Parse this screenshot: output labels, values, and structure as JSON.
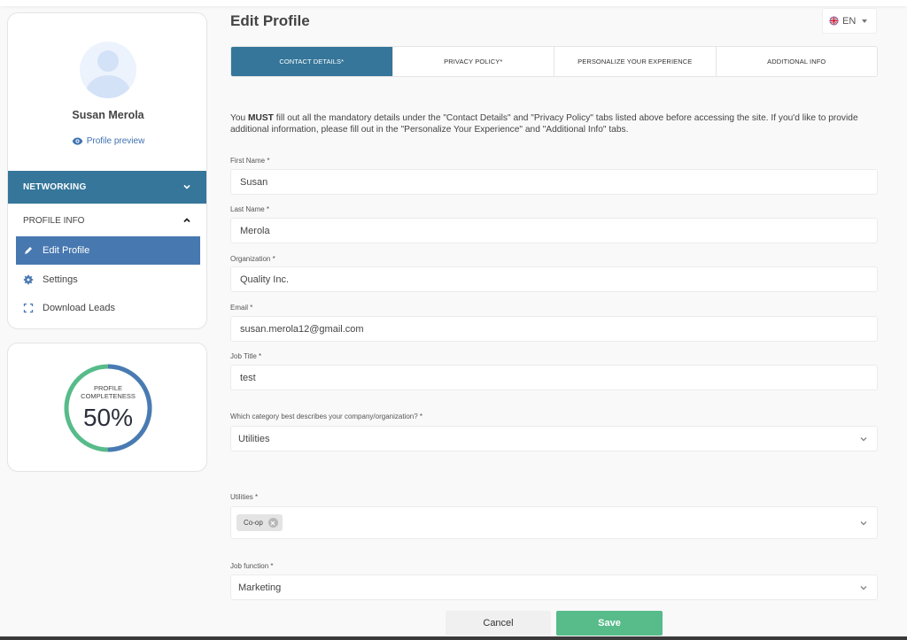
{
  "sidebar": {
    "user_name": "Susan Merola",
    "profile_preview": "Profile preview",
    "sections": [
      {
        "label": "NETWORKING",
        "expanded": false
      },
      {
        "label": "PROFILE INFO",
        "expanded": true
      }
    ],
    "items": [
      {
        "label": "Edit Profile",
        "icon": "pencil-icon",
        "active": true
      },
      {
        "label": "Settings",
        "icon": "gear-icon",
        "active": false
      },
      {
        "label": "Download Leads",
        "icon": "scan-icon",
        "active": false
      }
    ]
  },
  "completeness": {
    "label_line1": "PROFILE",
    "label_line2": "COMPLETENESS",
    "value_text": "50%",
    "fraction": 0.5,
    "colors": {
      "complete": "#4a7ab3",
      "remaining": "#57bb8a"
    }
  },
  "header": {
    "title": "Edit Profile",
    "language": "EN"
  },
  "tabs": [
    {
      "label": "CONTACT DETAILS*",
      "active": true
    },
    {
      "label": "PRIVACY POLICY*",
      "active": false
    },
    {
      "label": "PERSONALIZE YOUR EXPERIENCE",
      "active": false
    },
    {
      "label": "ADDITIONAL INFO",
      "active": false
    }
  ],
  "notice": {
    "prefix": "You ",
    "emphasis": "MUST",
    "text": " fill out all the mandatory details under the \"Contact Details\" and \"Privacy Policy\" tabs listed above before accessing the site. If you'd like to provide additional information, please fill out in the \"Personalize Your Experience\" and \"Additional Info\" tabs."
  },
  "form": {
    "first_name": {
      "label": "First Name *",
      "value": "Susan"
    },
    "last_name": {
      "label": "Last Name *",
      "value": "Merola"
    },
    "organization": {
      "label": "Organization *",
      "value": "Quality Inc."
    },
    "email": {
      "label": "Email *",
      "value": "susan.merola12@gmail.com"
    },
    "job_title": {
      "label": "Job Title *",
      "value": "test"
    },
    "category": {
      "label": "Which category best describes your company/organization? *",
      "value": "Utilities"
    },
    "utilities": {
      "label": "Utilities *",
      "chips": [
        "Co-op"
      ]
    },
    "job_function": {
      "label": "Job function *",
      "value": "Marketing"
    }
  },
  "actions": {
    "cancel": "Cancel",
    "save": "Save"
  },
  "colors": {
    "primary": "#35769a",
    "active_item": "#4878b0",
    "save": "#57bb8a",
    "link": "#3f72b0"
  }
}
